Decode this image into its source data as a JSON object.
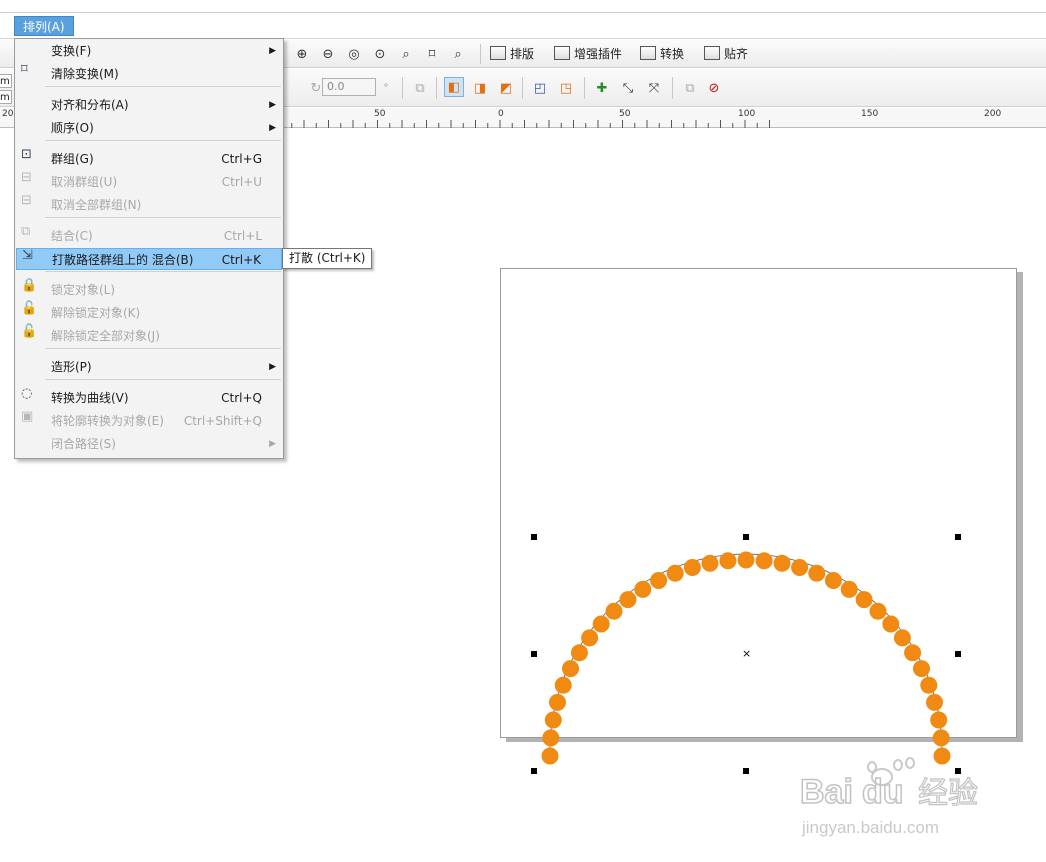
{
  "menubar": {
    "active_menu": "排列(A)"
  },
  "toolbar1": {
    "buttons": [
      "排版",
      "增强插件",
      "转换",
      "贴齐"
    ]
  },
  "toolbar2": {
    "angle_value": "0.0",
    "angle_unit": "°"
  },
  "side_labels": [
    "m",
    "m"
  ],
  "ruler": {
    "labels": [
      "50",
      "0",
      "50",
      "100",
      "150",
      "200"
    ],
    "left_stub": "20"
  },
  "arrange_menu": {
    "items": [
      {
        "label": "变换(F)",
        "shortcut": "",
        "submenu": true,
        "disabled": false,
        "icon": ""
      },
      {
        "label": "清除变换(M)",
        "shortcut": "",
        "submenu": false,
        "disabled": false,
        "icon": "clear-transform-icon"
      },
      {
        "label": "对齐和分布(A)",
        "shortcut": "",
        "submenu": true,
        "disabled": false,
        "icon": ""
      },
      {
        "label": "顺序(O)",
        "shortcut": "",
        "submenu": true,
        "disabled": false,
        "icon": ""
      },
      {
        "label": "群组(G)",
        "shortcut": "Ctrl+G",
        "submenu": false,
        "disabled": false,
        "icon": "group-icon"
      },
      {
        "label": "取消群组(U)",
        "shortcut": "Ctrl+U",
        "submenu": false,
        "disabled": true,
        "icon": "ungroup-icon"
      },
      {
        "label": "取消全部群组(N)",
        "shortcut": "",
        "submenu": false,
        "disabled": true,
        "icon": "ungroup-all-icon"
      },
      {
        "label": "结合(C)",
        "shortcut": "Ctrl+L",
        "submenu": false,
        "disabled": true,
        "icon": "combine-icon"
      },
      {
        "label": "打散路径群组上的  混合(B)",
        "shortcut": "Ctrl+K",
        "submenu": false,
        "disabled": false,
        "icon": "break-apart-icon",
        "highlighted": true
      },
      {
        "label": "锁定对象(L)",
        "shortcut": "",
        "submenu": false,
        "disabled": true,
        "icon": "lock-icon"
      },
      {
        "label": "解除锁定对象(K)",
        "shortcut": "",
        "submenu": false,
        "disabled": true,
        "icon": "unlock-icon"
      },
      {
        "label": "解除锁定全部对象(J)",
        "shortcut": "",
        "submenu": false,
        "disabled": true,
        "icon": "unlock-all-icon"
      },
      {
        "label": "造形(P)",
        "shortcut": "",
        "submenu": true,
        "disabled": false,
        "icon": ""
      },
      {
        "label": "转换为曲线(V)",
        "shortcut": "Ctrl+Q",
        "submenu": false,
        "disabled": false,
        "icon": "convert-to-curves-icon"
      },
      {
        "label": "将轮廓转换为对象(E)",
        "shortcut": "Ctrl+Shift+Q",
        "submenu": false,
        "disabled": true,
        "icon": "outline-to-object-icon"
      },
      {
        "label": "闭合路径(S)",
        "shortcut": "",
        "submenu": true,
        "disabled": true,
        "icon": ""
      }
    ]
  },
  "tooltip": {
    "text": "打散 (Ctrl+K)"
  },
  "artwork": {
    "dot_color": "#f08a12",
    "dot_count": 35
  },
  "watermark": {
    "brand": "Bai",
    "brand2": "du",
    "cn": "经验",
    "url": "jingyan.baidu.com"
  },
  "colors": {
    "menu_highlight": "#91c9f7",
    "active_menu": "#5aa0dd"
  }
}
